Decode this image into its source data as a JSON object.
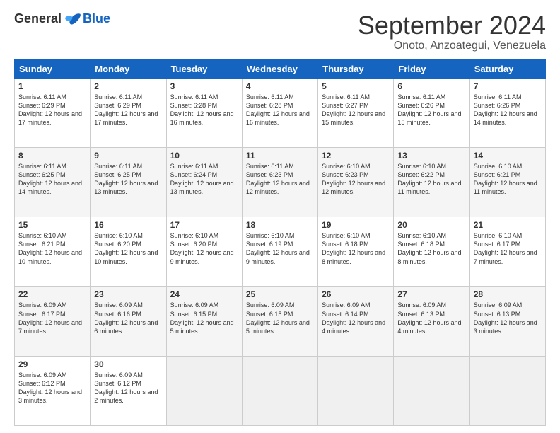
{
  "logo": {
    "general": "General",
    "blue": "Blue"
  },
  "header": {
    "month": "September 2024",
    "location": "Onoto, Anzoategui, Venezuela"
  },
  "days_of_week": [
    "Sunday",
    "Monday",
    "Tuesday",
    "Wednesday",
    "Thursday",
    "Friday",
    "Saturday"
  ],
  "weeks": [
    [
      {
        "day": "1",
        "sunrise": "6:11 AM",
        "sunset": "6:29 PM",
        "daylight": "12 hours and 17 minutes."
      },
      {
        "day": "2",
        "sunrise": "6:11 AM",
        "sunset": "6:29 PM",
        "daylight": "12 hours and 17 minutes."
      },
      {
        "day": "3",
        "sunrise": "6:11 AM",
        "sunset": "6:28 PM",
        "daylight": "12 hours and 16 minutes."
      },
      {
        "day": "4",
        "sunrise": "6:11 AM",
        "sunset": "6:28 PM",
        "daylight": "12 hours and 16 minutes."
      },
      {
        "day": "5",
        "sunrise": "6:11 AM",
        "sunset": "6:27 PM",
        "daylight": "12 hours and 15 minutes."
      },
      {
        "day": "6",
        "sunrise": "6:11 AM",
        "sunset": "6:26 PM",
        "daylight": "12 hours and 15 minutes."
      },
      {
        "day": "7",
        "sunrise": "6:11 AM",
        "sunset": "6:26 PM",
        "daylight": "12 hours and 14 minutes."
      }
    ],
    [
      {
        "day": "8",
        "sunrise": "6:11 AM",
        "sunset": "6:25 PM",
        "daylight": "12 hours and 14 minutes."
      },
      {
        "day": "9",
        "sunrise": "6:11 AM",
        "sunset": "6:25 PM",
        "daylight": "12 hours and 13 minutes."
      },
      {
        "day": "10",
        "sunrise": "6:11 AM",
        "sunset": "6:24 PM",
        "daylight": "12 hours and 13 minutes."
      },
      {
        "day": "11",
        "sunrise": "6:11 AM",
        "sunset": "6:23 PM",
        "daylight": "12 hours and 12 minutes."
      },
      {
        "day": "12",
        "sunrise": "6:10 AM",
        "sunset": "6:23 PM",
        "daylight": "12 hours and 12 minutes."
      },
      {
        "day": "13",
        "sunrise": "6:10 AM",
        "sunset": "6:22 PM",
        "daylight": "12 hours and 11 minutes."
      },
      {
        "day": "14",
        "sunrise": "6:10 AM",
        "sunset": "6:21 PM",
        "daylight": "12 hours and 11 minutes."
      }
    ],
    [
      {
        "day": "15",
        "sunrise": "6:10 AM",
        "sunset": "6:21 PM",
        "daylight": "12 hours and 10 minutes."
      },
      {
        "day": "16",
        "sunrise": "6:10 AM",
        "sunset": "6:20 PM",
        "daylight": "12 hours and 10 minutes."
      },
      {
        "day": "17",
        "sunrise": "6:10 AM",
        "sunset": "6:20 PM",
        "daylight": "12 hours and 9 minutes."
      },
      {
        "day": "18",
        "sunrise": "6:10 AM",
        "sunset": "6:19 PM",
        "daylight": "12 hours and 9 minutes."
      },
      {
        "day": "19",
        "sunrise": "6:10 AM",
        "sunset": "6:18 PM",
        "daylight": "12 hours and 8 minutes."
      },
      {
        "day": "20",
        "sunrise": "6:10 AM",
        "sunset": "6:18 PM",
        "daylight": "12 hours and 8 minutes."
      },
      {
        "day": "21",
        "sunrise": "6:10 AM",
        "sunset": "6:17 PM",
        "daylight": "12 hours and 7 minutes."
      }
    ],
    [
      {
        "day": "22",
        "sunrise": "6:09 AM",
        "sunset": "6:17 PM",
        "daylight": "12 hours and 7 minutes."
      },
      {
        "day": "23",
        "sunrise": "6:09 AM",
        "sunset": "6:16 PM",
        "daylight": "12 hours and 6 minutes."
      },
      {
        "day": "24",
        "sunrise": "6:09 AM",
        "sunset": "6:15 PM",
        "daylight": "12 hours and 5 minutes."
      },
      {
        "day": "25",
        "sunrise": "6:09 AM",
        "sunset": "6:15 PM",
        "daylight": "12 hours and 5 minutes."
      },
      {
        "day": "26",
        "sunrise": "6:09 AM",
        "sunset": "6:14 PM",
        "daylight": "12 hours and 4 minutes."
      },
      {
        "day": "27",
        "sunrise": "6:09 AM",
        "sunset": "6:13 PM",
        "daylight": "12 hours and 4 minutes."
      },
      {
        "day": "28",
        "sunrise": "6:09 AM",
        "sunset": "6:13 PM",
        "daylight": "12 hours and 3 minutes."
      }
    ],
    [
      {
        "day": "29",
        "sunrise": "6:09 AM",
        "sunset": "6:12 PM",
        "daylight": "12 hours and 3 minutes."
      },
      {
        "day": "30",
        "sunrise": "6:09 AM",
        "sunset": "6:12 PM",
        "daylight": "12 hours and 2 minutes."
      },
      {
        "day": "",
        "sunrise": "",
        "sunset": "",
        "daylight": ""
      },
      {
        "day": "",
        "sunrise": "",
        "sunset": "",
        "daylight": ""
      },
      {
        "day": "",
        "sunrise": "",
        "sunset": "",
        "daylight": ""
      },
      {
        "day": "",
        "sunrise": "",
        "sunset": "",
        "daylight": ""
      },
      {
        "day": "",
        "sunrise": "",
        "sunset": "",
        "daylight": ""
      }
    ]
  ]
}
